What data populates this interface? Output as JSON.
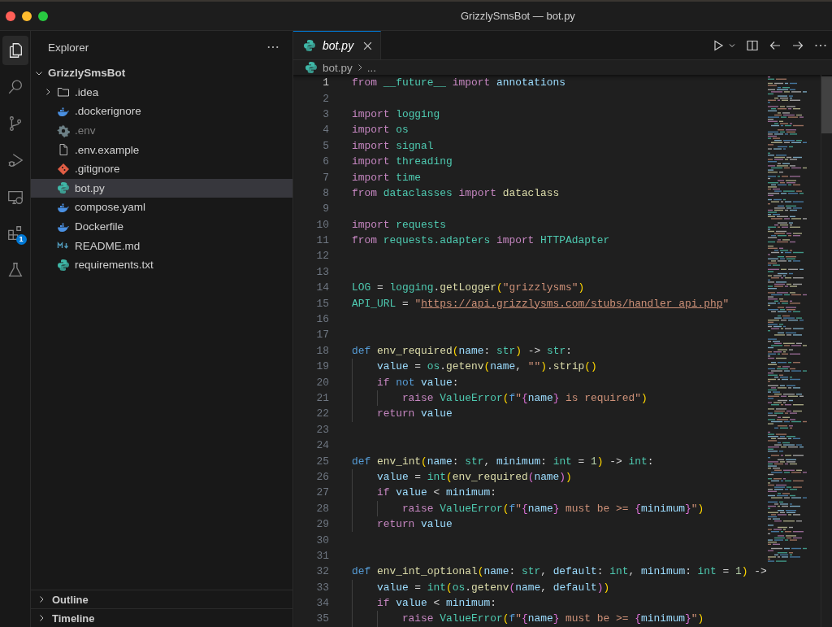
{
  "window": {
    "title": "GrizzlySmsBot — bot.py"
  },
  "activity_bar": [
    {
      "kind": "files",
      "selected": true
    },
    {
      "kind": "search",
      "selected": false
    },
    {
      "kind": "source-control",
      "selected": false
    },
    {
      "kind": "run-debug",
      "selected": false
    },
    {
      "kind": "remote",
      "selected": false
    },
    {
      "kind": "extensions",
      "selected": false,
      "badge": "1"
    },
    {
      "kind": "testing",
      "selected": false
    }
  ],
  "sidebar": {
    "title": "Explorer",
    "root": {
      "label": "GrizzlySmsBot",
      "expanded": true,
      "children": [
        {
          "label": ".idea",
          "kind": "folder",
          "expanded": false,
          "selected": false,
          "ignored": false
        },
        {
          "label": ".dockerignore",
          "kind": "docker",
          "selected": false,
          "ignored": false
        },
        {
          "label": ".env",
          "kind": "gear",
          "selected": false,
          "ignored": true
        },
        {
          "label": ".env.example",
          "kind": "file",
          "selected": false,
          "ignored": false
        },
        {
          "label": ".gitignore",
          "kind": "git",
          "selected": false,
          "ignored": false
        },
        {
          "label": "bot.py",
          "kind": "python",
          "selected": true,
          "ignored": false
        },
        {
          "label": "compose.yaml",
          "kind": "docker",
          "selected": false,
          "ignored": false
        },
        {
          "label": "Dockerfile",
          "kind": "docker",
          "selected": false,
          "ignored": false
        },
        {
          "label": "README.md",
          "kind": "markdown",
          "selected": false,
          "ignored": false
        },
        {
          "label": "requirements.txt",
          "kind": "python",
          "selected": false,
          "ignored": false
        }
      ]
    },
    "sections": [
      {
        "label": "Outline",
        "expanded": false
      },
      {
        "label": "Timeline",
        "expanded": false
      }
    ]
  },
  "tabs": [
    {
      "label": "bot.py",
      "kind": "python",
      "selected": true,
      "preview": true
    }
  ],
  "breadcrumb": [
    {
      "label": "bot.py",
      "kind": "python"
    },
    {
      "label": "...",
      "kind": "more"
    }
  ],
  "editor": {
    "lines": [
      {
        "number": "1",
        "active": true,
        "tokens": [
          {
            "kind": "kw",
            "text": "from"
          },
          {
            "kind": "mod",
            "text": " __future__"
          },
          {
            "kind": "kw",
            "text": " import"
          },
          {
            "kind": "var",
            "text": " annotations"
          }
        ]
      },
      {
        "number": "2",
        "active": false
      },
      {
        "number": "3",
        "active": false,
        "tokens": [
          {
            "kind": "kw",
            "text": "import"
          },
          {
            "kind": "mod",
            "text": " logging"
          }
        ]
      },
      {
        "number": "4",
        "active": false,
        "tokens": [
          {
            "kind": "kw",
            "text": "import"
          },
          {
            "kind": "mod",
            "text": " os"
          }
        ]
      },
      {
        "number": "5",
        "active": false,
        "tokens": [
          {
            "kind": "kw",
            "text": "import"
          },
          {
            "kind": "mod",
            "text": " signal"
          }
        ]
      },
      {
        "number": "6",
        "active": false,
        "tokens": [
          {
            "kind": "kw",
            "text": "import"
          },
          {
            "kind": "mod",
            "text": " threading"
          }
        ]
      },
      {
        "number": "7",
        "active": false,
        "tokens": [
          {
            "kind": "kw",
            "text": "import"
          },
          {
            "kind": "mod",
            "text": " time"
          }
        ]
      },
      {
        "number": "8",
        "active": false,
        "tokens": [
          {
            "kind": "kw",
            "text": "from"
          },
          {
            "kind": "mod",
            "text": " dataclasses"
          },
          {
            "kind": "kw",
            "text": " import"
          },
          {
            "kind": "fn",
            "text": " dataclass"
          }
        ]
      },
      {
        "number": "9",
        "active": false
      },
      {
        "number": "10",
        "active": false,
        "tokens": [
          {
            "kind": "kw",
            "text": "import"
          },
          {
            "kind": "mod",
            "text": " requests"
          }
        ]
      },
      {
        "number": "11",
        "active": false,
        "tokens": [
          {
            "kind": "kw",
            "text": "from"
          },
          {
            "kind": "mod",
            "text": " requests.adapters"
          },
          {
            "kind": "kw",
            "text": " import"
          },
          {
            "kind": "mod",
            "text": " HTTPAdapter"
          }
        ]
      },
      {
        "number": "12",
        "active": false
      },
      {
        "number": "13",
        "active": false
      },
      {
        "number": "14",
        "active": false,
        "tokens": [
          {
            "kind": "mod",
            "text": "LOG"
          },
          {
            "kind": "p",
            "text": " = "
          },
          {
            "kind": "mod",
            "text": "logging"
          },
          {
            "kind": "p",
            "text": "."
          },
          {
            "kind": "fn",
            "text": "getLogger"
          },
          {
            "kind": "br1",
            "text": "("
          },
          {
            "kind": "str",
            "text": "\"grizzlysms\""
          },
          {
            "kind": "br1",
            "text": ")"
          }
        ]
      },
      {
        "number": "15",
        "active": false,
        "tokens": [
          {
            "kind": "mod",
            "text": "API_URL"
          },
          {
            "kind": "p",
            "text": " = "
          },
          {
            "kind": "str",
            "text": "\""
          },
          {
            "kind": "url",
            "text": "https://api.grizzlysms.com/stubs/handler_api.php"
          },
          {
            "kind": "str",
            "text": "\""
          }
        ]
      },
      {
        "number": "16",
        "active": false
      },
      {
        "number": "17",
        "active": false
      },
      {
        "number": "18",
        "active": false,
        "tokens": [
          {
            "kind": "def",
            "text": "def"
          },
          {
            "kind": "fn",
            "text": " env_required"
          },
          {
            "kind": "br1",
            "text": "("
          },
          {
            "kind": "var",
            "text": "name"
          },
          {
            "kind": "p",
            "text": ": "
          },
          {
            "kind": "mod",
            "text": "str"
          },
          {
            "kind": "br1",
            "text": ")"
          },
          {
            "kind": "p",
            "text": " -> "
          },
          {
            "kind": "mod",
            "text": "str"
          },
          {
            "kind": "p",
            "text": ":"
          }
        ]
      },
      {
        "number": "19",
        "active": false,
        "tokens": [
          {
            "kind": "var",
            "text": "    value"
          },
          {
            "kind": "p",
            "text": " = "
          },
          {
            "kind": "mod",
            "text": "os"
          },
          {
            "kind": "p",
            "text": "."
          },
          {
            "kind": "fn",
            "text": "getenv"
          },
          {
            "kind": "br1",
            "text": "("
          },
          {
            "kind": "var",
            "text": "name"
          },
          {
            "kind": "p",
            "text": ", "
          },
          {
            "kind": "str",
            "text": "\"\""
          },
          {
            "kind": "br1",
            "text": ")"
          },
          {
            "kind": "p",
            "text": "."
          },
          {
            "kind": "fn",
            "text": "strip"
          },
          {
            "kind": "br1",
            "text": "()"
          }
        ]
      },
      {
        "number": "20",
        "active": false,
        "tokens": [
          {
            "kind": "kw",
            "text": "    if"
          },
          {
            "kind": "def",
            "text": " not"
          },
          {
            "kind": "var",
            "text": " value"
          },
          {
            "kind": "p",
            "text": ":"
          }
        ]
      },
      {
        "number": "21",
        "active": false,
        "tokens": [
          {
            "kind": "kw",
            "text": "        raise"
          },
          {
            "kind": "mod",
            "text": " ValueError"
          },
          {
            "kind": "br1",
            "text": "("
          },
          {
            "kind": "def",
            "text": "f"
          },
          {
            "kind": "str",
            "text": "\""
          },
          {
            "kind": "br2",
            "text": "{"
          },
          {
            "kind": "var",
            "text": "name"
          },
          {
            "kind": "br2",
            "text": "}"
          },
          {
            "kind": "str",
            "text": " is required\""
          },
          {
            "kind": "br1",
            "text": ")"
          }
        ]
      },
      {
        "number": "22",
        "active": false,
        "tokens": [
          {
            "kind": "kw",
            "text": "    return"
          },
          {
            "kind": "var",
            "text": " value"
          }
        ]
      },
      {
        "number": "23",
        "active": false
      },
      {
        "number": "24",
        "active": false
      },
      {
        "number": "25",
        "active": false,
        "tokens": [
          {
            "kind": "def",
            "text": "def"
          },
          {
            "kind": "fn",
            "text": " env_int"
          },
          {
            "kind": "br1",
            "text": "("
          },
          {
            "kind": "var",
            "text": "name"
          },
          {
            "kind": "p",
            "text": ": "
          },
          {
            "kind": "mod",
            "text": "str"
          },
          {
            "kind": "p",
            "text": ", "
          },
          {
            "kind": "var",
            "text": "minimum"
          },
          {
            "kind": "p",
            "text": ": "
          },
          {
            "kind": "mod",
            "text": "int"
          },
          {
            "kind": "p",
            "text": " = "
          },
          {
            "kind": "num",
            "text": "1"
          },
          {
            "kind": "br1",
            "text": ")"
          },
          {
            "kind": "p",
            "text": " -> "
          },
          {
            "kind": "mod",
            "text": "int"
          },
          {
            "kind": "p",
            "text": ":"
          }
        ]
      },
      {
        "number": "26",
        "active": false,
        "tokens": [
          {
            "kind": "var",
            "text": "    value"
          },
          {
            "kind": "p",
            "text": " = "
          },
          {
            "kind": "mod",
            "text": "int"
          },
          {
            "kind": "br1",
            "text": "("
          },
          {
            "kind": "fn",
            "text": "env_required"
          },
          {
            "kind": "br2",
            "text": "("
          },
          {
            "kind": "var",
            "text": "name"
          },
          {
            "kind": "br2",
            "text": ")"
          },
          {
            "kind": "br1",
            "text": ")"
          }
        ]
      },
      {
        "number": "27",
        "active": false,
        "tokens": [
          {
            "kind": "kw",
            "text": "    if"
          },
          {
            "kind": "var",
            "text": " value"
          },
          {
            "kind": "p",
            "text": " < "
          },
          {
            "kind": "var",
            "text": "minimum"
          },
          {
            "kind": "p",
            "text": ":"
          }
        ]
      },
      {
        "number": "28",
        "active": false,
        "tokens": [
          {
            "kind": "kw",
            "text": "        raise"
          },
          {
            "kind": "mod",
            "text": " ValueError"
          },
          {
            "kind": "br1",
            "text": "("
          },
          {
            "kind": "def",
            "text": "f"
          },
          {
            "kind": "str",
            "text": "\""
          },
          {
            "kind": "br2",
            "text": "{"
          },
          {
            "kind": "var",
            "text": "name"
          },
          {
            "kind": "br2",
            "text": "}"
          },
          {
            "kind": "str",
            "text": " must be >= "
          },
          {
            "kind": "br2",
            "text": "{"
          },
          {
            "kind": "var",
            "text": "minimum"
          },
          {
            "kind": "br2",
            "text": "}"
          },
          {
            "kind": "str",
            "text": "\""
          },
          {
            "kind": "br1",
            "text": ")"
          }
        ]
      },
      {
        "number": "29",
        "active": false,
        "tokens": [
          {
            "kind": "kw",
            "text": "    return"
          },
          {
            "kind": "var",
            "text": " value"
          }
        ]
      },
      {
        "number": "30",
        "active": false
      },
      {
        "number": "31",
        "active": false
      },
      {
        "number": "32",
        "active": false,
        "tokens": [
          {
            "kind": "def",
            "text": "def"
          },
          {
            "kind": "fn",
            "text": " env_int_optional"
          },
          {
            "kind": "br1",
            "text": "("
          },
          {
            "kind": "var",
            "text": "name"
          },
          {
            "kind": "p",
            "text": ": "
          },
          {
            "kind": "mod",
            "text": "str"
          },
          {
            "kind": "p",
            "text": ", "
          },
          {
            "kind": "var",
            "text": "default"
          },
          {
            "kind": "p",
            "text": ": "
          },
          {
            "kind": "mod",
            "text": "int"
          },
          {
            "kind": "p",
            "text": ", "
          },
          {
            "kind": "var",
            "text": "minimum"
          },
          {
            "kind": "p",
            "text": ": "
          },
          {
            "kind": "mod",
            "text": "int"
          },
          {
            "kind": "p",
            "text": " = "
          },
          {
            "kind": "num",
            "text": "1"
          },
          {
            "kind": "br1",
            "text": ")"
          },
          {
            "kind": "p",
            "text": " ->"
          }
        ]
      },
      {
        "number": "33",
        "active": false,
        "tokens": [
          {
            "kind": "var",
            "text": "    value"
          },
          {
            "kind": "p",
            "text": " = "
          },
          {
            "kind": "mod",
            "text": "int"
          },
          {
            "kind": "br1",
            "text": "("
          },
          {
            "kind": "mod",
            "text": "os"
          },
          {
            "kind": "p",
            "text": "."
          },
          {
            "kind": "fn",
            "text": "getenv"
          },
          {
            "kind": "br2",
            "text": "("
          },
          {
            "kind": "var",
            "text": "name"
          },
          {
            "kind": "p",
            "text": ", "
          },
          {
            "kind": "var",
            "text": "default"
          },
          {
            "kind": "br2",
            "text": ")"
          },
          {
            "kind": "br1",
            "text": ")"
          }
        ]
      },
      {
        "number": "34",
        "active": false,
        "tokens": [
          {
            "kind": "kw",
            "text": "    if"
          },
          {
            "kind": "var",
            "text": " value"
          },
          {
            "kind": "p",
            "text": " < "
          },
          {
            "kind": "var",
            "text": "minimum"
          },
          {
            "kind": "p",
            "text": ":"
          }
        ]
      },
      {
        "number": "35",
        "active": false,
        "tokens": [
          {
            "kind": "kw",
            "text": "        raise"
          },
          {
            "kind": "mod",
            "text": " ValueError"
          },
          {
            "kind": "br1",
            "text": "("
          },
          {
            "kind": "def",
            "text": "f"
          },
          {
            "kind": "str",
            "text": "\""
          },
          {
            "kind": "br2",
            "text": "{"
          },
          {
            "kind": "var",
            "text": "name"
          },
          {
            "kind": "br2",
            "text": "}"
          },
          {
            "kind": "str",
            "text": " must be >= "
          },
          {
            "kind": "br2",
            "text": "{"
          },
          {
            "kind": "var",
            "text": "minimum"
          },
          {
            "kind": "br2",
            "text": "}"
          },
          {
            "kind": "str",
            "text": "\""
          },
          {
            "kind": "br1",
            "text": ")"
          }
        ]
      }
    ]
  }
}
